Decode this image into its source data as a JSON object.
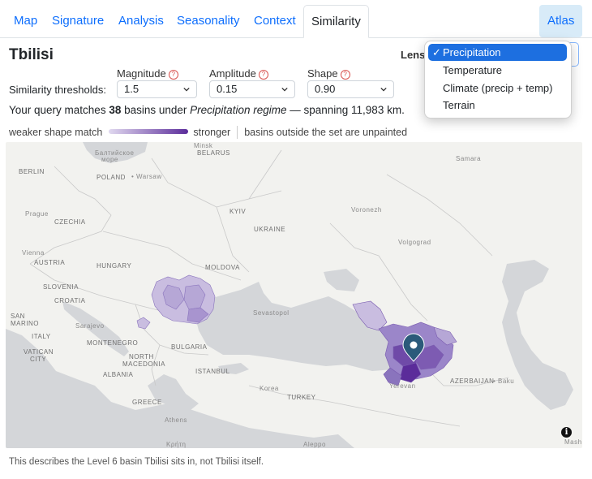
{
  "tabs": [
    {
      "label": "Map"
    },
    {
      "label": "Signature"
    },
    {
      "label": "Analysis"
    },
    {
      "label": "Seasonality"
    },
    {
      "label": "Context"
    },
    {
      "label": "Similarity"
    }
  ],
  "atlas_label": "Atlas",
  "place_title": "Tbilisi",
  "lens": {
    "label": "Lens",
    "options": [
      "Precipitation",
      "Temperature",
      "Climate (precip + temp)",
      "Terrain"
    ],
    "selected": "Precipitation",
    "check": "✓"
  },
  "thresholds": {
    "label": "Similarity thresholds:",
    "magnitude": {
      "header": "Magnitude",
      "value": "1.5"
    },
    "amplitude": {
      "header": "Amplitude",
      "value": "0.15"
    },
    "shape": {
      "header": "Shape",
      "value": "0.90"
    },
    "help_glyph": "?"
  },
  "summary": {
    "prefix": "Your query matches ",
    "count": "38",
    "mid": " basins under ",
    "regime": "Precipitation regime",
    "suffix": " — spanning 11,983 km."
  },
  "legend": {
    "weak": "weaker shape match",
    "strong": "stronger",
    "note": "basins outside the set are unpainted"
  },
  "map_labels": {
    "baltic": "Балтийское",
    "baltic2": "море",
    "minsk": "Minsk",
    "belarus": "BELARUS",
    "berlin": "BERLIN",
    "poland": "POLAND",
    "warsaw": "• Warsaw",
    "prague": "Prague",
    "czechia": "CZECHIA",
    "kyiv": "KYIV",
    "ukraine": "UKRAINE",
    "voronezh": "Voronezh",
    "samara": "Samara",
    "vienna": "Vienna",
    "austria": "AUSTRIA",
    "hungary": "HUNGARY",
    "moldova": "MOLDOVA",
    "volgograd": "Volgograd",
    "slovenia": "SLOVENIA",
    "croatia": "CROATIA",
    "sevastopol": "Sevastopol",
    "sanmarino": "SAN",
    "sanmarino2": "MARINO",
    "sarajevo": "Sarajevo",
    "italy": "ITALY",
    "vatican": "VATICAN",
    "vatican2": "CITY",
    "montenegro": "MONTENEGRO",
    "bulgaria": "BULGARIA",
    "north_macedonia": "NORTH",
    "north_macedonia2": "MACEDONIA",
    "istanbul": "ISTANBUL",
    "albania": "ALBANIA",
    "korea": "Korea",
    "azerbaijan": "AZERBAIJAN",
    "baku": "• Baku",
    "turkey": "TURKEY",
    "greece": "GREECE",
    "athens": "Athens",
    "mediterranean": "Κρήτη",
    "aleppo": "Aleppo",
    "mashh": "Mashh",
    "yerevan": "Yerevan",
    "info": "i"
  },
  "footnote": "This describes the Level 6 basin Tbilisi sits in, not Tbilisi itself.",
  "colors": {
    "accent": "#0d6efd",
    "selected_option": "#1d6fe0",
    "basin_light": "#c9bde0",
    "basin_dark": "#5b2c9a",
    "pin": "#2b5a7a",
    "sea": "#d4d6d9",
    "land": "#f2f2ef"
  }
}
